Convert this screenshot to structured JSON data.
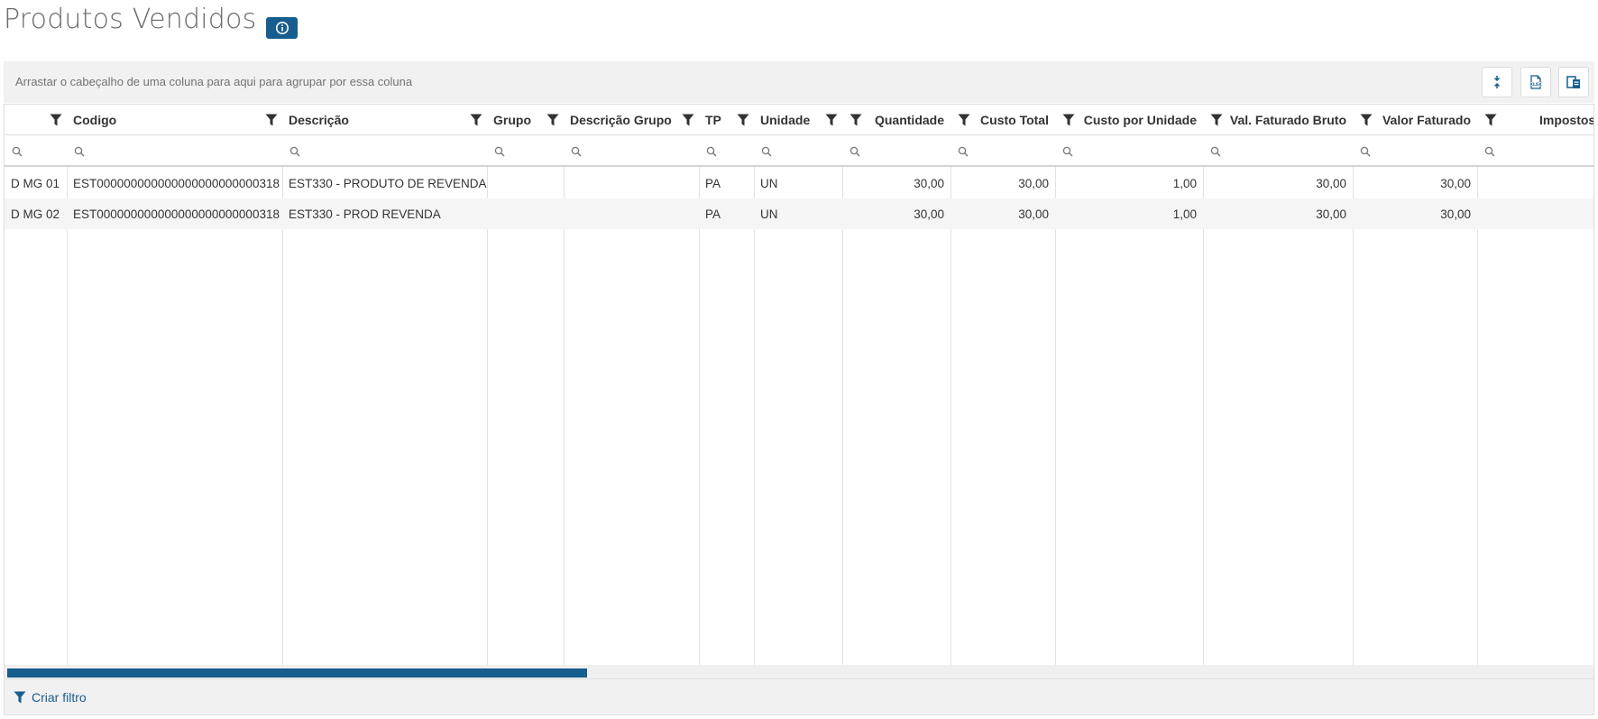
{
  "page": {
    "title": "Produtos Vendidos"
  },
  "group_panel": {
    "hint": "Arrastar o cabeçalho de uma coluna para aqui para agrupar por essa coluna"
  },
  "toolbar": {
    "icons": [
      "collapse-rows-icon",
      "export-xls-icon",
      "column-chooser-icon"
    ]
  },
  "grid": {
    "columns": [
      {
        "label": "",
        "align": "left"
      },
      {
        "label": "Codigo",
        "align": "left"
      },
      {
        "label": "Descrição",
        "align": "left"
      },
      {
        "label": "Grupo",
        "align": "left"
      },
      {
        "label": "Descrição Grupo",
        "align": "left"
      },
      {
        "label": "TP",
        "align": "left"
      },
      {
        "label": "Unidade",
        "align": "left"
      },
      {
        "label": "Quantidade",
        "align": "right"
      },
      {
        "label": "Custo Total",
        "align": "right"
      },
      {
        "label": "Custo por Unidade",
        "align": "right"
      },
      {
        "label": "Val. Faturado Bruto",
        "align": "right"
      },
      {
        "label": "Valor Faturado",
        "align": "right"
      },
      {
        "label": "Impostos não",
        "align": "right"
      }
    ],
    "rows": [
      [
        "D MG 01",
        "EST000000000000000000000000318",
        "EST330 - PRODUTO DE REVENDA",
        "",
        "",
        "PA",
        "UN",
        "30,00",
        "30,00",
        "1,00",
        "30,00",
        "30,00",
        ""
      ],
      [
        "D MG 02",
        "EST000000000000000000000000318",
        "EST330 - PROD REVENDA",
        "",
        "",
        "PA",
        "UN",
        "30,00",
        "30,00",
        "1,00",
        "30,00",
        "30,00",
        ""
      ]
    ]
  },
  "footer": {
    "create_filter_label": "Criar filtro"
  },
  "colors": {
    "accent": "#175d8e",
    "panel": "#f1f1f1",
    "alt_row": "#f5f5f5"
  }
}
